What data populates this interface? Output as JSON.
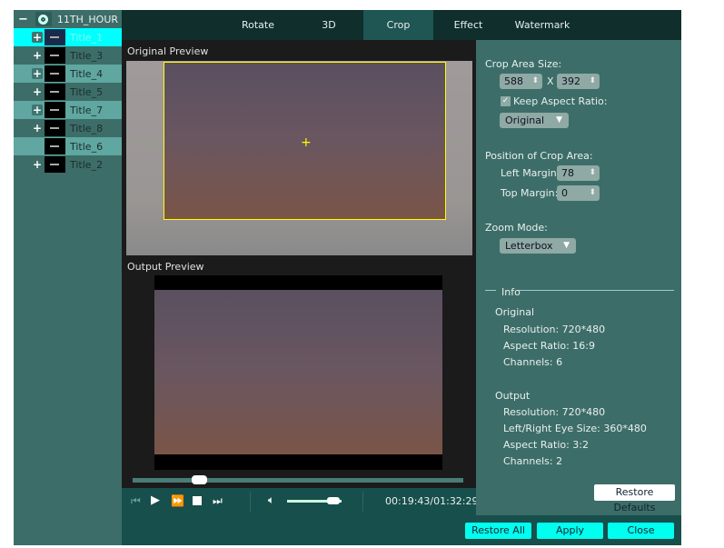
{
  "sidebar": {
    "root": "11TH_HOUR",
    "items": [
      {
        "label": "Title_1",
        "expander": "boxed-plus",
        "state": "selected"
      },
      {
        "label": "Title_3",
        "expander": "plus"
      },
      {
        "label": "Title_4",
        "expander": "boxed-plus"
      },
      {
        "label": "Title_5",
        "expander": "plus"
      },
      {
        "label": "Title_7",
        "expander": "boxed-plus"
      },
      {
        "label": "Title_8",
        "expander": "plus"
      },
      {
        "label": "Title_6",
        "expander": "none"
      },
      {
        "label": "Title_2",
        "expander": "plus"
      }
    ]
  },
  "tabs": [
    {
      "label": "Rotate"
    },
    {
      "label": "3D"
    },
    {
      "label": "Crop",
      "active": true
    },
    {
      "label": "Effect"
    },
    {
      "label": "Watermark"
    }
  ],
  "preview": {
    "original_label": "Original Preview",
    "output_label": "Output Preview",
    "time": "00:19:43/01:32:29",
    "progress": 0.2,
    "volume": 0.85
  },
  "crop": {
    "size_label": "Crop Area Size:",
    "width": "588",
    "x": "X",
    "height": "392",
    "keep_aspect_label": "Keep Aspect Ratio:",
    "keep_aspect": true,
    "aspect_value": "Original",
    "position_label": "Position of Crop Area:",
    "left_label": "Left Margin:",
    "left_value": "78",
    "top_label": "Top Margin:",
    "top_value": "0",
    "zoom_label": "Zoom Mode:",
    "zoom_value": "Letterbox"
  },
  "info": {
    "title": "Info",
    "original": "Original",
    "orig_res": "Resolution: 720*480",
    "orig_aspect": "Aspect Ratio: 16:9",
    "orig_channels": "Channels: 6",
    "output": "Output",
    "out_res": "Resolution: 720*480",
    "out_eye": "Left/Right Eye Size: 360*480",
    "out_aspect": "Aspect Ratio: 3:2",
    "out_channels": "Channels: 2"
  },
  "buttons": {
    "restore_defaults": "Restore Defaults",
    "restore_all": "Restore All",
    "apply": "Apply",
    "close": "Close"
  },
  "colors": {
    "accent": "#00ffee",
    "panel": "#3d6d68",
    "crop_frame": "#ffff00"
  }
}
